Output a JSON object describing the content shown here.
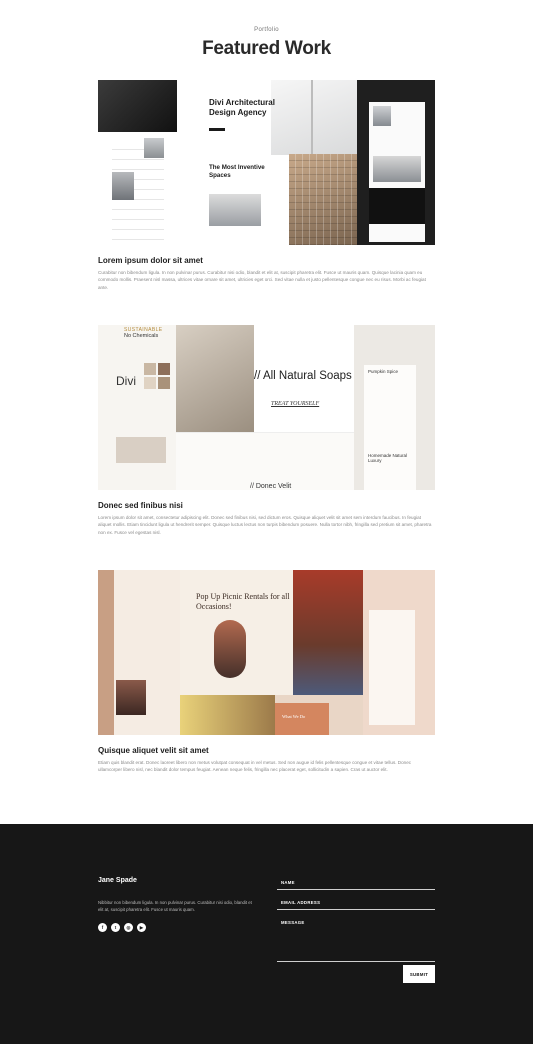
{
  "header": {
    "eyebrow": "Portfolio",
    "title": "Featured Work"
  },
  "projects": [
    {
      "title": "Lorem ipsum dolor sit amet",
      "description": "Curabitur non bibendum ligula. In non pulvinar purus. Curabitur nisi odio, blandit et elit at, suscipit pharetra elit. Fusce ut mauris quam. Quisque lacinia quam eu commodo mollis. Praesent nisl massa, ultrices vitae ornare sit amet, ultricies eget orci. Sed vitae nulla et justo pellentesque congue nec eu risus. Morbi ac feugiat ante.",
      "mockup": {
        "headline": "Divi Architectural Design Agency",
        "subheadline": "The Most Inventive Spaces"
      }
    },
    {
      "title": "Donec sed finibus nisi",
      "description": "Lorem ipsum dolor sit amet, consectetur adipiscing elit. Donec sed finibus nisi, sed dictum eros. Quisque aliquet velit sit amet sem interdum faucibus. In feugiat aliquet mollis. Etiam tincidunt ligula ut hendrerit semper. Quisque luctus lectus non turpis bibendum posuere. Nulla tortor nibh, fringilla sed pretium sit amet, pharetra non ex. Fusce vel egestas nisl.",
      "mockup": {
        "sustainable": "SUSTAINABLE",
        "no_chemicals": "No Chemicals",
        "divi": "Divi",
        "headline": "// All Natural Soaps",
        "tagline": "TREAT YOURSELF",
        "lower_text": "// Donec Velit",
        "side_title": "Pumpkin Spice",
        "side_title_2": "Homemade Natural Luxury"
      }
    },
    {
      "title": "Quisque aliquet velit sit amet",
      "description": "Etiam quis blandit erat. Donec laoreet libero non metus volutpat consequat in vel metus. Sed non augue id felis pellentesque congue et vitae tellus. Donec ullamcorper libero nisl, nec blandit dolor tempus feugiat. Aenean neque felis, fringilla nec placerat eget, sollicitudin a sapien. Cras ut auctor elit.",
      "mockup": {
        "headline": "Pop Up Picnic Rentals for all Occasions!",
        "panel_title": "What We Do"
      }
    }
  ],
  "footer": {
    "name": "Jane Spade",
    "bio": "Nibbitur non bibendum ligula. In non pulvinar purus. Curabitur nisi odio, blandit et elit at, suscipit pharetra elit. Fusce ut mauris quam.",
    "socials": [
      {
        "icon": "facebook-icon",
        "glyph": "f"
      },
      {
        "icon": "twitter-icon",
        "glyph": "t"
      },
      {
        "icon": "instagram-icon",
        "glyph": "◎"
      },
      {
        "icon": "youtube-icon",
        "glyph": "▶"
      }
    ],
    "form": {
      "name_label": "NAME",
      "email_label": "EMAIL ADDRESS",
      "message_label": "MESSAGE",
      "submit_label": "SUBMIT"
    }
  }
}
